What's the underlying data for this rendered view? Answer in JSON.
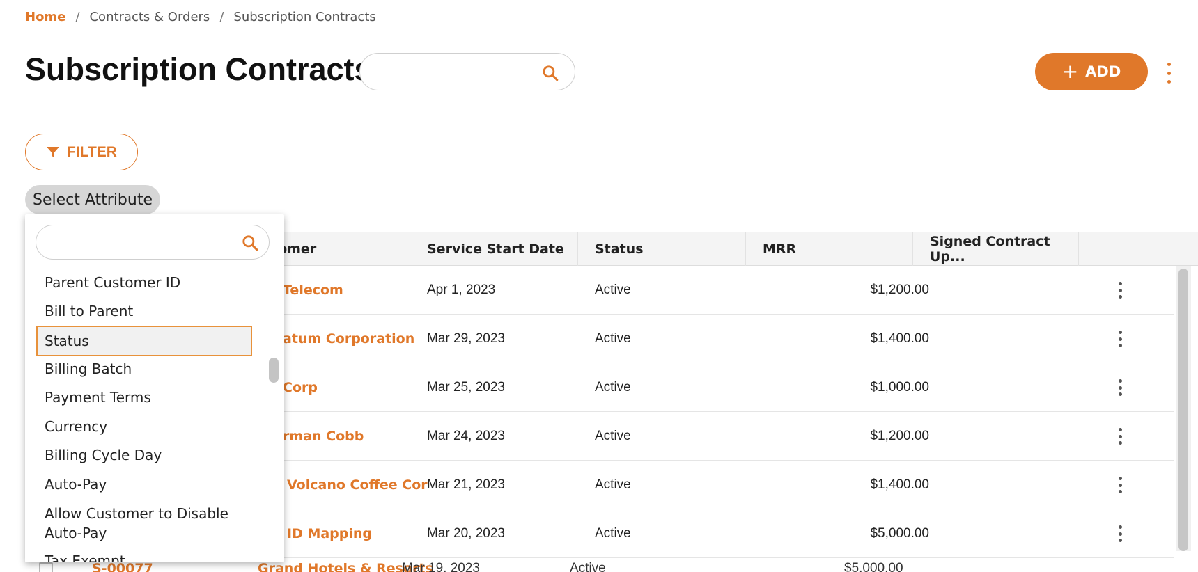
{
  "breadcrumb": {
    "home": "Home",
    "separator": "/",
    "level1": "Contracts & Orders",
    "level2": "Subscription Contracts"
  },
  "page_title": "Subscription Contracts",
  "search": {
    "placeholder": "",
    "value": ""
  },
  "toolbar": {
    "add_label": "ADD",
    "add_icon": "plus-icon",
    "more_icon": "kebab-icon"
  },
  "filter": {
    "label": "FILTER",
    "icon": "funnel-icon"
  },
  "select_attribute": {
    "label": "Select Attribute",
    "search_placeholder": "",
    "items": [
      "Parent Customer ID",
      "Bill to Parent",
      "Status",
      "Billing Batch",
      "Payment Terms",
      "Currency",
      "Billing Cycle Day",
      "Auto-Pay",
      "Allow Customer to Disable Auto-Pay",
      "Tax Exempt"
    ],
    "selected": "Status"
  },
  "table": {
    "columns": [
      "tomer",
      "Service Start Date",
      "Status",
      "MRR",
      "Signed Contract Up..."
    ],
    "rows": [
      {
        "customer": "Telecom",
        "start": "Apr 1, 2023",
        "status": "Active",
        "mrr": "$1,200.00"
      },
      {
        "customer": "atum Corporation",
        "start": "Mar 29, 2023",
        "status": "Active",
        "mrr": "$1,400.00"
      },
      {
        "customer": "Corp",
        "start": "Mar 25, 2023",
        "status": "Active",
        "mrr": "$1,000.00"
      },
      {
        "customer": "rman Cobb",
        "start": "Mar 24, 2023",
        "status": "Active",
        "mrr": "$1,200.00"
      },
      {
        "customer": "Volcano Coffee Cor",
        "start": "Mar 21, 2023",
        "status": "Active",
        "mrr": "$1,400.00"
      },
      {
        "customer": "ID Mapping",
        "start": "Mar 20, 2023",
        "status": "Active",
        "mrr": "$5,000.00"
      }
    ],
    "partial_row": {
      "id": "S-00077",
      "customer": "Grand Hotels & Resorts",
      "start": "Mar 19, 2023",
      "status": "Active",
      "mrr": "$5,000.00"
    }
  },
  "colors": {
    "accent": "#e0782a",
    "header_bg": "#f4f4f4",
    "chip_bg": "#d6d6d6"
  }
}
